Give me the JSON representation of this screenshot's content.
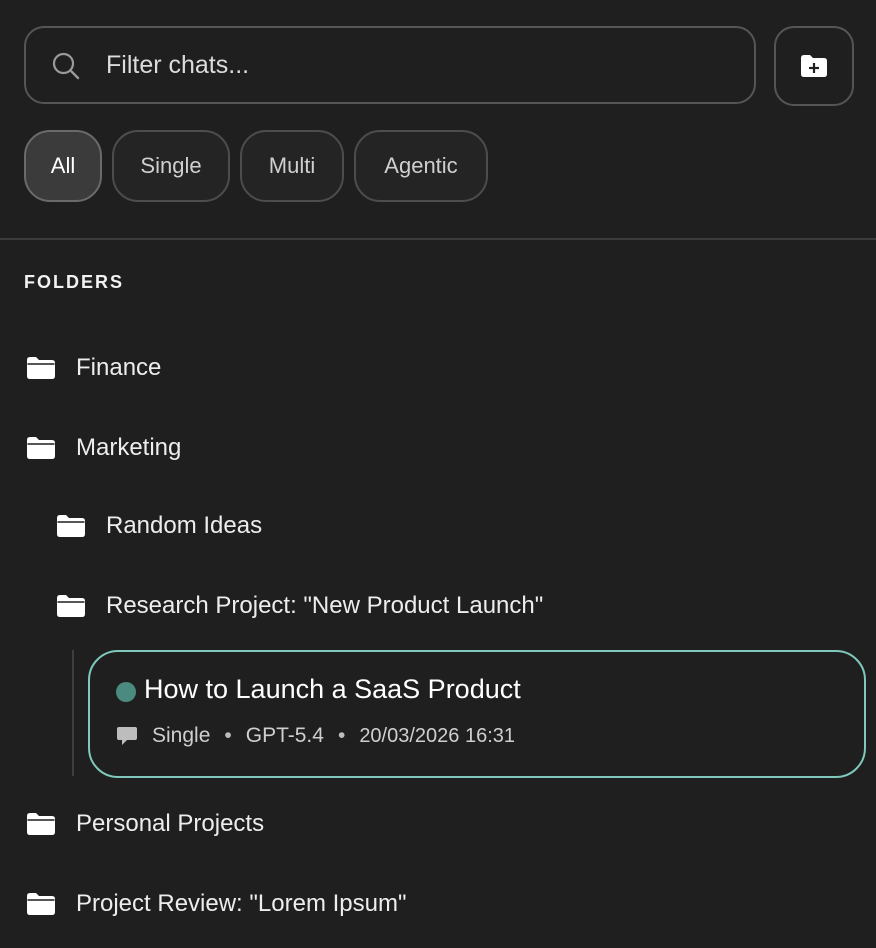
{
  "search": {
    "placeholder": "Filter chats..."
  },
  "filters": [
    {
      "label": "All",
      "active": true
    },
    {
      "label": "Single",
      "active": false
    },
    {
      "label": "Multi",
      "active": false
    },
    {
      "label": "Agentic",
      "active": false
    }
  ],
  "folders_section": {
    "title": "FOLDERS",
    "items": [
      {
        "label": "Finance"
      },
      {
        "label": "Marketing"
      },
      {
        "label": "Random Ideas"
      },
      {
        "label": "Research Project: \"New Product Launch\""
      },
      {
        "label": "Personal Projects"
      },
      {
        "label": "Project Review: \"Lorem Ipsum\""
      }
    ]
  },
  "chat": {
    "title": "How to Launch a SaaS Product",
    "type": "Single",
    "model": "GPT-5.4",
    "timestamp": "20/03/2026 16:31",
    "separator": "•"
  },
  "colors": {
    "background": "#1f1f1f",
    "border": "#555555",
    "accent": "#7fc8bb",
    "status_dot": "#4a8a7f"
  },
  "icons": {
    "search": "search-icon",
    "new_folder": "folder-plus-icon",
    "folder": "folder-icon",
    "chat": "chat-bubble-icon"
  }
}
